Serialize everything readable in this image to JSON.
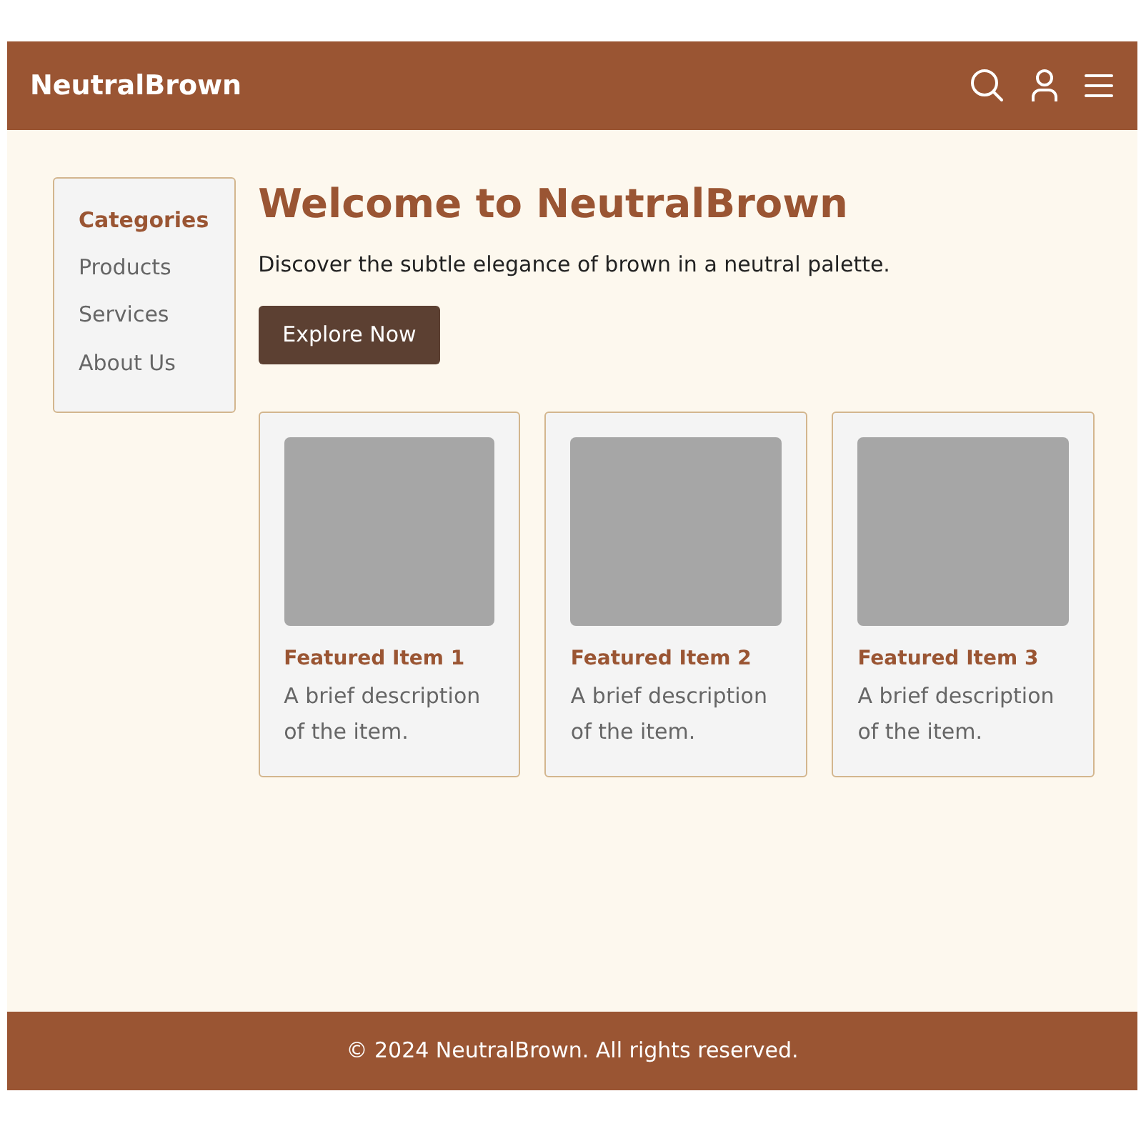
{
  "header": {
    "brand": "NeutralBrown"
  },
  "sidebar": {
    "title": "Categories",
    "items": [
      "Products",
      "Services",
      "About Us"
    ]
  },
  "hero": {
    "title": "Welcome to NeutralBrown",
    "text": "Discover the subtle elegance of brown in a neutral palette.",
    "button": "Explore Now"
  },
  "cards": [
    {
      "title": "Featured Item 1",
      "text": "A brief description of the item."
    },
    {
      "title": "Featured Item 2",
      "text": "A brief description of the item."
    },
    {
      "title": "Featured Item 3",
      "text": "A brief description of the item."
    }
  ],
  "footer": {
    "text": "© 2024 NeutralBrown. All rights reserved."
  }
}
